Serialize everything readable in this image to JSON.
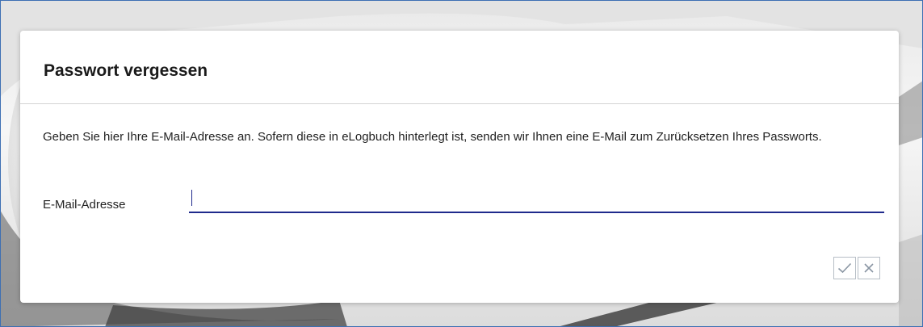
{
  "dialog": {
    "title": "Passwort vergessen",
    "description": "Geben Sie hier Ihre E-Mail-Adresse an. Sofern diese in eLogbuch hinterlegt ist, senden wir Ihnen eine E-Mail zum Zurücksetzen Ihres Passworts.",
    "email_field": {
      "label": "E-Mail-Adresse",
      "value": ""
    },
    "actions": {
      "confirm_icon": "checkmark-icon",
      "cancel_icon": "close-icon"
    }
  },
  "colors": {
    "input_underline": "#1f2a8c",
    "window_border": "#3d6fb3",
    "button_border": "#b7bec6",
    "icon_color": "#8a96a3"
  }
}
